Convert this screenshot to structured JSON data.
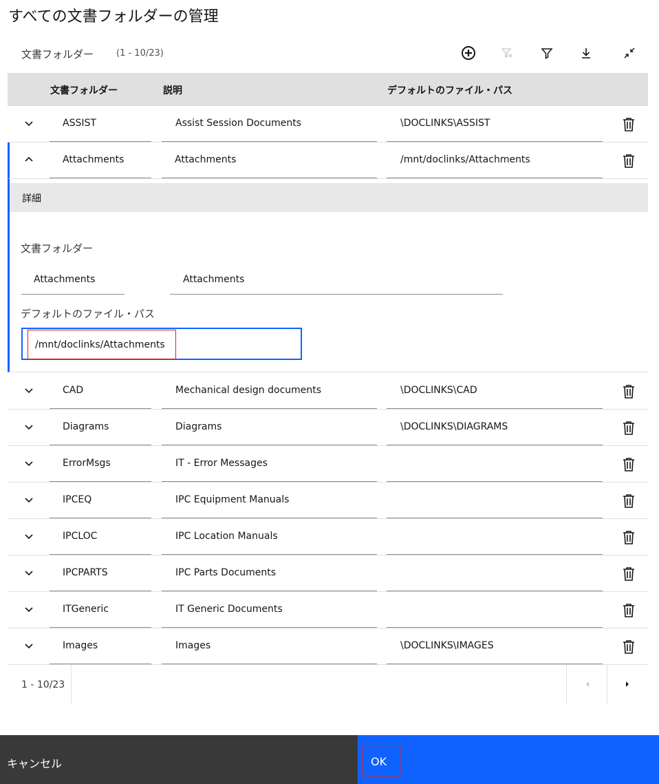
{
  "page": {
    "title": "すべての文書フォルダーの管理"
  },
  "toolbar": {
    "title": "文書フォルダー",
    "count": "(1 - 10/23)",
    "icons": [
      "add-icon",
      "clear-filter-icon",
      "filter-icon",
      "download-icon",
      "collapse-icon"
    ]
  },
  "table": {
    "headers": {
      "folder": "文書フォルダー",
      "description": "説明",
      "path": "デフォルトのファイル・パス"
    },
    "rows": [
      {
        "folder": "ASSIST",
        "description": "Assist Session Documents",
        "path": "\\DOCLINKS\\ASSIST"
      },
      {
        "folder": "Attachments",
        "description": "Attachments",
        "path": "/mnt/doclinks/Attachments"
      },
      {
        "folder": "CAD",
        "description": "Mechanical design documents",
        "path": "\\DOCLINKS\\CAD"
      },
      {
        "folder": "Diagrams",
        "description": "Diagrams",
        "path": "\\DOCLINKS\\DIAGRAMS"
      },
      {
        "folder": "ErrorMsgs",
        "description": "IT - Error Messages",
        "path": ""
      },
      {
        "folder": "IPCEQ",
        "description": "IPC Equipment Manuals",
        "path": ""
      },
      {
        "folder": "IPCLOC",
        "description": "IPC Location Manuals",
        "path": ""
      },
      {
        "folder": "IPCPARTS",
        "description": "IPC Parts Documents",
        "path": ""
      },
      {
        "folder": "ITGeneric",
        "description": "IT Generic Documents",
        "path": ""
      },
      {
        "folder": "Images",
        "description": "Images",
        "path": "\\DOCLINKS\\IMAGES"
      }
    ]
  },
  "details": {
    "heading": "詳細",
    "folder_label": "文書フォルダー",
    "folder_value": "Attachments",
    "folder_description": "Attachments",
    "path_label": "デフォルトのファイル・パス",
    "path_value": "/mnt/doclinks/Attachments"
  },
  "pagination": {
    "count": "1 - 10/23"
  },
  "footer": {
    "cancel_label": "キャンセル",
    "ok_label": "OK"
  },
  "colors": {
    "primary": "#0f62fe",
    "dark": "#393939",
    "highlight": "#da1e28",
    "header_bg": "#e0e0e0"
  }
}
